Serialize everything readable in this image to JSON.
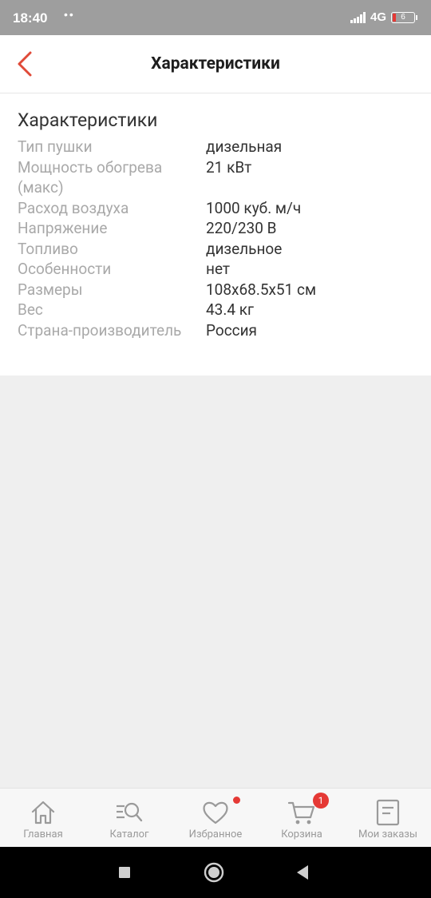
{
  "status_bar": {
    "time": "18:40",
    "notification_dots": "••",
    "network": "4G",
    "battery_level": "6"
  },
  "header": {
    "title": "Характеристики",
    "back_icon": "chevron-left-icon"
  },
  "specs": {
    "heading": "Характеристики",
    "rows": [
      {
        "label": "Тип пушки",
        "value": "дизельная"
      },
      {
        "label": "Мощность обогрева (макс)",
        "value": "21 кВт"
      },
      {
        "label": "Расход воздуха",
        "value": "1000 куб. м/ч"
      },
      {
        "label": "Напряжение",
        "value": "220/230 В"
      },
      {
        "label": "Топливо",
        "value": "дизельное"
      },
      {
        "label": "Особенности",
        "value": "нет"
      },
      {
        "label": "Размеры",
        "value": "108x68.5x51 см"
      },
      {
        "label": "Вес",
        "value": "43.4 кг"
      },
      {
        "label": "Страна-производитель",
        "value": "Россия"
      }
    ]
  },
  "bottom_nav": {
    "items": [
      {
        "label": "Главная",
        "icon": "home-icon"
      },
      {
        "label": "Каталог",
        "icon": "catalog-search-icon"
      },
      {
        "label": "Избранное",
        "icon": "heart-icon"
      },
      {
        "label": "Корзина",
        "icon": "cart-icon",
        "badge": "1"
      },
      {
        "label": "Мои заказы",
        "icon": "orders-icon"
      }
    ]
  },
  "colors": {
    "accent": "#e53935",
    "status_bar": "#9e9e9e",
    "page_background": "#efefef"
  }
}
